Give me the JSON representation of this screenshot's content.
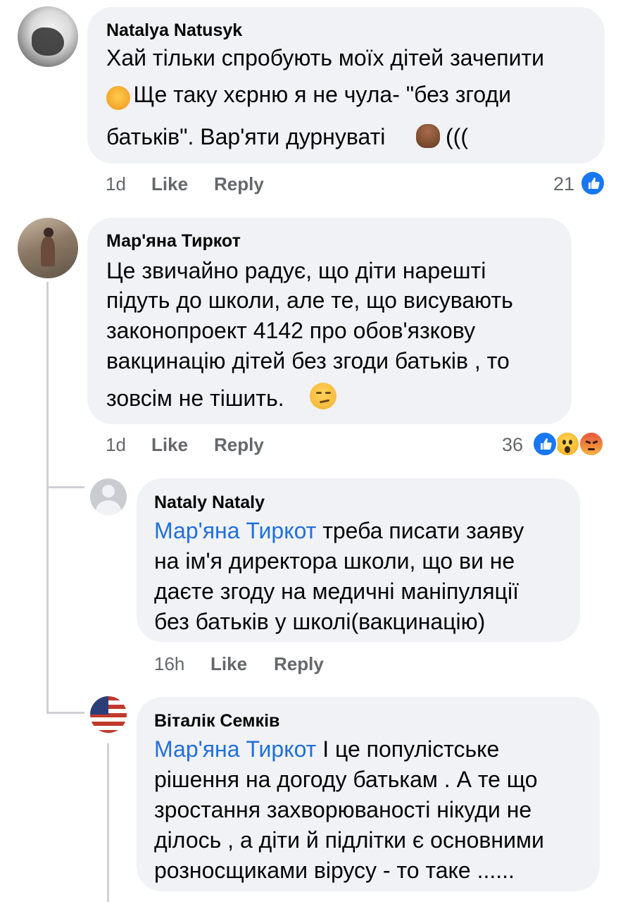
{
  "comments": [
    {
      "author": "Natalya Natusyk",
      "lines": [
        "Хай тільки спробують моїх дітей зачепити",
        "Ще таку хєрню я не чула- \"без згоди",
        "батьків\". Вар'яти дурнуваті",
        "((("
      ],
      "emoji": [
        "woman-facepalming-emoji",
        "pile-of-poo-emoji"
      ],
      "time": "1d",
      "like": "Like",
      "reply": "Reply",
      "reaction_count": "21",
      "reactions": [
        "like-reaction-icon"
      ]
    },
    {
      "author": "Мар'яна Тиркот",
      "lines": [
        "Це звичайно радує, що діти нарешті",
        "підуть до школи, але те, що висувають",
        "законопроект 4142 про обов'язкову",
        "вакцинацію дітей без згоди батьків , то",
        "зовсім не тішить."
      ],
      "emoji": [
        "smirking-face-emoji"
      ],
      "time": "1d",
      "like": "Like",
      "reply": "Reply",
      "reaction_count": "36",
      "reactions": [
        "like-reaction-icon",
        "wow-reaction-icon",
        "angry-reaction-icon"
      ]
    },
    {
      "author": "Nataly Nataly",
      "mention": "Мар'яна Тиркот",
      "lines": [
        " треба писати заяву",
        "на ім'я директора школи, що ви не",
        "даєте згоду на медичні маніпуляції",
        "без батьків у школі(вакцинацію)"
      ],
      "time": "16h",
      "like": "Like",
      "reply": "Reply"
    },
    {
      "author": "Віталік Семків",
      "mention": "Мар'яна Тиркот",
      "lines": [
        " І це популістське",
        "рішення на догоду батькам . А те що",
        "зростання захворюваності нікуди не",
        "ділось , а діти й підлітки є основними",
        "розносщиками вірусу - то таке ......"
      ]
    }
  ],
  "colors": {
    "bubble": "#f0f2f5",
    "meta_text": "#65676b",
    "mention": "#216fdb",
    "like_blue": "#1877f2",
    "thread_line": "#ced0d4"
  }
}
